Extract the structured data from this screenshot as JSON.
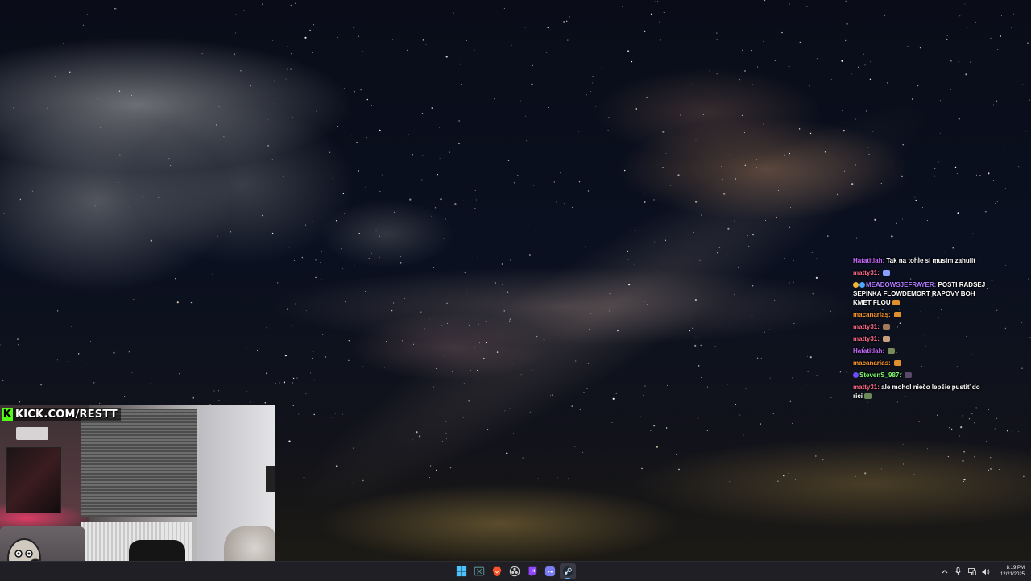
{
  "webcam": {
    "logo_text": "KICK.COM/RESTT"
  },
  "chat": {
    "messages": [
      {
        "user": "Hatatitlah",
        "sep": ":",
        "text": "Tak na tohle si musim zahulit",
        "user_color": "#c86bff",
        "emotes": []
      },
      {
        "user": "matty31",
        "sep": ":",
        "text": "",
        "user_color": "#ff6b8a",
        "emotes": [
          "#8aa0ff"
        ]
      },
      {
        "user": "MEADOWSJEFRAYER",
        "sep": ":",
        "text": "POSTI RADSEJ SEPINKA FLOWDEMORT RAPOVY BOH KMET FLOU",
        "user_color": "#b07bff",
        "badges": [
          "#f2b233",
          "#4aa8ff"
        ],
        "emotes": [
          "#e0902a"
        ]
      },
      {
        "user": "macanarias",
        "sep": ":",
        "text": "",
        "user_color": "#ff9a2e",
        "emotes": [
          "#e0902a"
        ]
      },
      {
        "user": "matty31",
        "sep": ":",
        "text": "",
        "user_color": "#ff6b8a",
        "emotes": [
          "#a07a5a"
        ]
      },
      {
        "user": "matty31",
        "sep": ":",
        "text": "",
        "user_color": "#ff6b8a",
        "emotes": [
          "#c8a080"
        ]
      },
      {
        "user": "Hatatitlah",
        "sep": ":",
        "text": "",
        "user_color": "#c86bff",
        "emotes": [
          "#7a8a5a"
        ]
      },
      {
        "user": "macanarias",
        "sep": ":",
        "text": "",
        "user_color": "#ff9a2e",
        "emotes": [
          "#e0902a"
        ]
      },
      {
        "user": "StevenS_987",
        "sep": ":",
        "text": "",
        "user_color": "#7cff6b",
        "badges": [
          "#6b4aff"
        ],
        "emotes": [
          "#5a4a6a"
        ]
      },
      {
        "user": "matty31",
        "sep": ":",
        "text": "ale mohol niečo lepšie pustiť do rici",
        "user_color": "#ff6b8a",
        "emotes": [
          "#6a8a5a"
        ]
      }
    ]
  },
  "taskbar": {
    "apps": [
      {
        "name": "start-button",
        "icon": "windows-logo-icon",
        "color": "#4cc2ff",
        "active": false
      },
      {
        "name": "xbox-app-button",
        "icon": "xbox-icon",
        "color": "#5a8f8f",
        "active": false
      },
      {
        "name": "brave-browser-button",
        "icon": "brave-lion-icon",
        "color": "#fb542b",
        "active": false
      },
      {
        "name": "obs-button",
        "icon": "obs-icon",
        "color": "#cfcfcf",
        "active": false
      },
      {
        "name": "twitch-studio-button",
        "icon": "twitch-icon",
        "color": "#9146ff",
        "active": false
      },
      {
        "name": "discord-button",
        "icon": "discord-icon",
        "color": "#7a7cf0",
        "active": false
      },
      {
        "name": "steam-button",
        "icon": "steam-icon",
        "color": "#dfe4ea",
        "active": true
      }
    ],
    "time": "8:19 PM",
    "date": "12/21/2025"
  }
}
